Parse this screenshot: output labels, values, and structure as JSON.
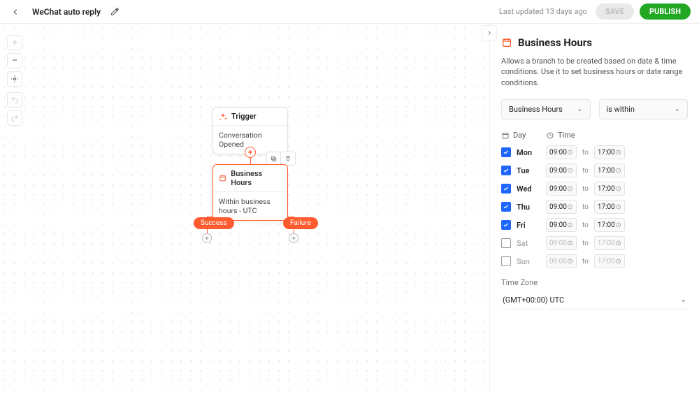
{
  "header": {
    "title": "WeChat auto reply",
    "last_updated": "Last updated 13 days ago",
    "save_label": "SAVE",
    "publish_label": "PUBLISH"
  },
  "canvas": {
    "trigger": {
      "title": "Trigger",
      "subtitle": "Conversation Opened"
    },
    "business_hours": {
      "title": "Business Hours",
      "subtitle": "Within business hours - UTC"
    },
    "branch_success": "Success",
    "branch_failure": "Failure"
  },
  "panel": {
    "title": "Business Hours",
    "description": "Allows a branch to be created based on date & time conditions. Use it to set business hours or date range conditions.",
    "select_type": "Business Hours",
    "select_op": "is within",
    "col_day": "Day",
    "col_time": "Time",
    "days": [
      {
        "label": "Mon",
        "checked": true,
        "from": "09:00",
        "to": "17:00"
      },
      {
        "label": "Tue",
        "checked": true,
        "from": "09:00",
        "to": "17:00"
      },
      {
        "label": "Wed",
        "checked": true,
        "from": "09:00",
        "to": "17:00"
      },
      {
        "label": "Thu",
        "checked": true,
        "from": "09:00",
        "to": "17:00"
      },
      {
        "label": "Fri",
        "checked": true,
        "from": "09:00",
        "to": "17:00"
      },
      {
        "label": "Sat",
        "checked": false,
        "from": "09:00",
        "to": "17:00"
      },
      {
        "label": "Sun",
        "checked": false,
        "from": "09:00",
        "to": "17:00"
      }
    ],
    "to_label": "to",
    "tz_label": "Time Zone",
    "tz_value": "(GMT+00:00) UTC"
  }
}
